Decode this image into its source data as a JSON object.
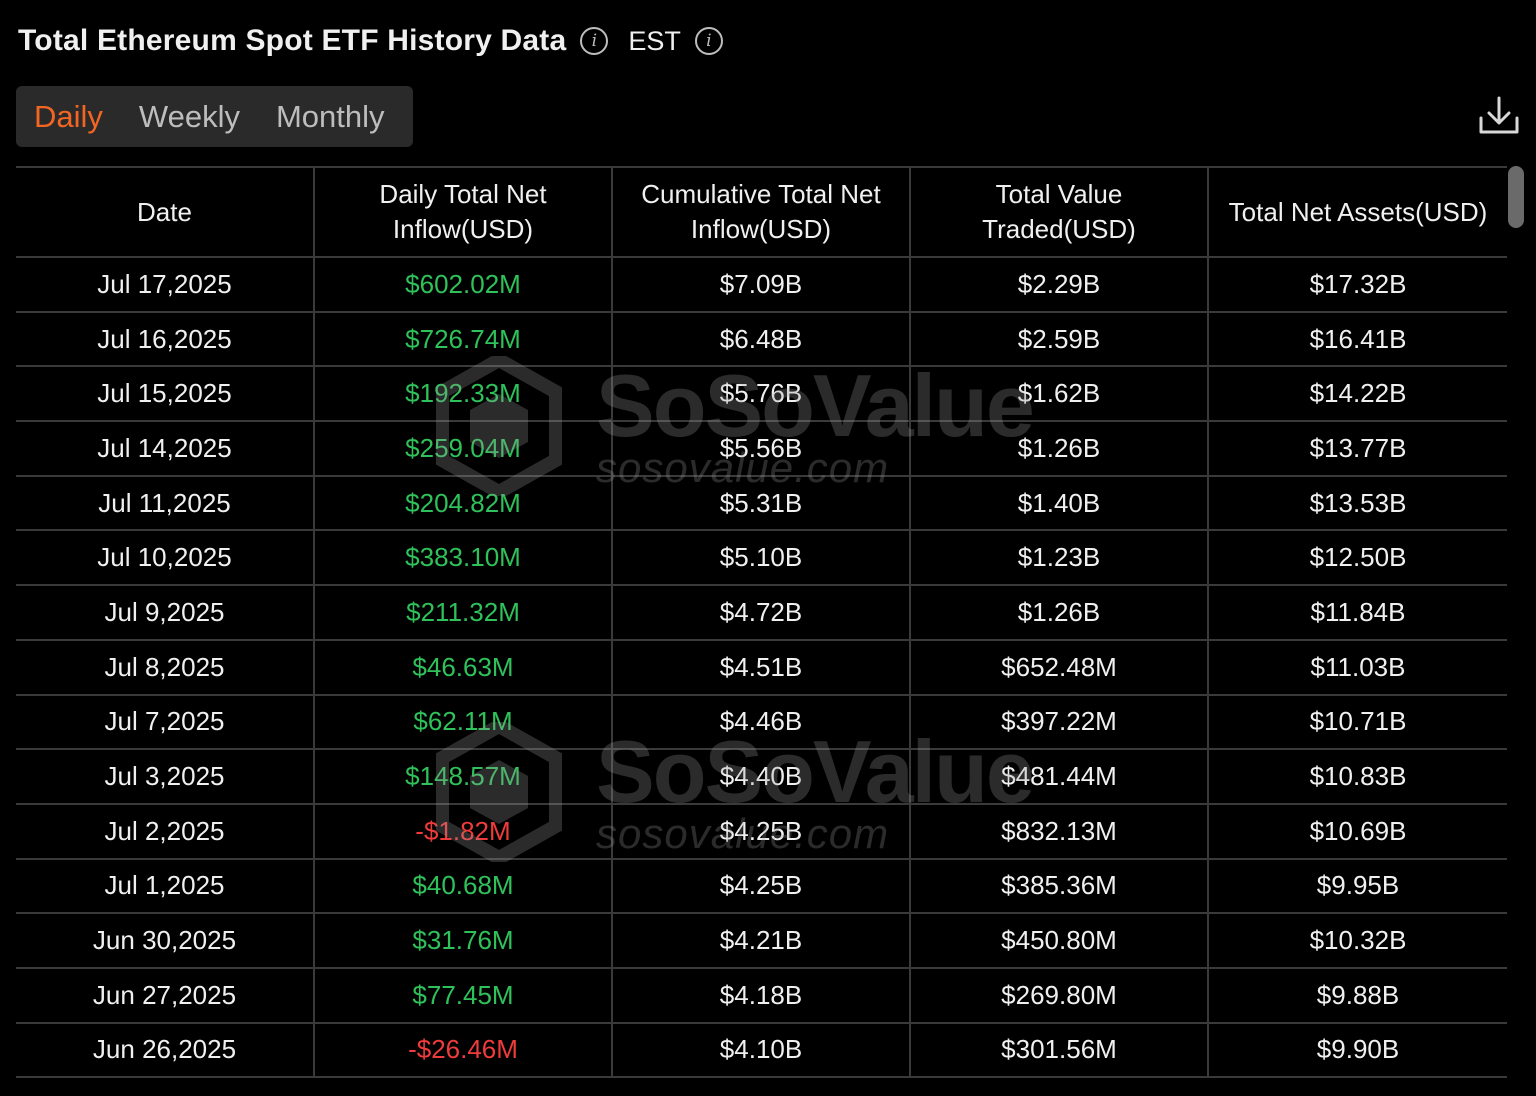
{
  "header": {
    "title": "Total Ethereum Spot ETF History Data",
    "timezone": "EST"
  },
  "tabs": [
    {
      "label": "Daily",
      "active": true
    },
    {
      "label": "Weekly",
      "active": false
    },
    {
      "label": "Monthly",
      "active": false
    }
  ],
  "colors": {
    "accent": "#f26522",
    "positive": "#2fc15a",
    "negative": "#ef3b3b"
  },
  "table": {
    "columns": [
      "Date",
      "Daily Total Net Inflow(USD)",
      "Cumulative Total Net Inflow(USD)",
      "Total Value Traded(USD)",
      "Total Net Assets(USD)"
    ],
    "rows": [
      {
        "date": "Jul 17,2025",
        "daily_net_inflow": "$602.02M",
        "cumulative_net_inflow": "$7.09B",
        "value_traded": "$2.29B",
        "net_assets": "$17.32B"
      },
      {
        "date": "Jul 16,2025",
        "daily_net_inflow": "$726.74M",
        "cumulative_net_inflow": "$6.48B",
        "value_traded": "$2.59B",
        "net_assets": "$16.41B"
      },
      {
        "date": "Jul 15,2025",
        "daily_net_inflow": "$192.33M",
        "cumulative_net_inflow": "$5.76B",
        "value_traded": "$1.62B",
        "net_assets": "$14.22B"
      },
      {
        "date": "Jul 14,2025",
        "daily_net_inflow": "$259.04M",
        "cumulative_net_inflow": "$5.56B",
        "value_traded": "$1.26B",
        "net_assets": "$13.77B"
      },
      {
        "date": "Jul 11,2025",
        "daily_net_inflow": "$204.82M",
        "cumulative_net_inflow": "$5.31B",
        "value_traded": "$1.40B",
        "net_assets": "$13.53B"
      },
      {
        "date": "Jul 10,2025",
        "daily_net_inflow": "$383.10M",
        "cumulative_net_inflow": "$5.10B",
        "value_traded": "$1.23B",
        "net_assets": "$12.50B"
      },
      {
        "date": "Jul 9,2025",
        "daily_net_inflow": "$211.32M",
        "cumulative_net_inflow": "$4.72B",
        "value_traded": "$1.26B",
        "net_assets": "$11.84B"
      },
      {
        "date": "Jul 8,2025",
        "daily_net_inflow": "$46.63M",
        "cumulative_net_inflow": "$4.51B",
        "value_traded": "$652.48M",
        "net_assets": "$11.03B"
      },
      {
        "date": "Jul 7,2025",
        "daily_net_inflow": "$62.11M",
        "cumulative_net_inflow": "$4.46B",
        "value_traded": "$397.22M",
        "net_assets": "$10.71B"
      },
      {
        "date": "Jul 3,2025",
        "daily_net_inflow": "$148.57M",
        "cumulative_net_inflow": "$4.40B",
        "value_traded": "$481.44M",
        "net_assets": "$10.83B"
      },
      {
        "date": "Jul 2,2025",
        "daily_net_inflow": "-$1.82M",
        "cumulative_net_inflow": "$4.25B",
        "value_traded": "$832.13M",
        "net_assets": "$10.69B"
      },
      {
        "date": "Jul 1,2025",
        "daily_net_inflow": "$40.68M",
        "cumulative_net_inflow": "$4.25B",
        "value_traded": "$385.36M",
        "net_assets": "$9.95B"
      },
      {
        "date": "Jun 30,2025",
        "daily_net_inflow": "$31.76M",
        "cumulative_net_inflow": "$4.21B",
        "value_traded": "$450.80M",
        "net_assets": "$10.32B"
      },
      {
        "date": "Jun 27,2025",
        "daily_net_inflow": "$77.45M",
        "cumulative_net_inflow": "$4.18B",
        "value_traded": "$269.80M",
        "net_assets": "$9.88B"
      },
      {
        "date": "Jun 26,2025",
        "daily_net_inflow": "-$26.46M",
        "cumulative_net_inflow": "$4.10B",
        "value_traded": "$301.56M",
        "net_assets": "$9.90B"
      }
    ]
  },
  "watermark": {
    "brand": "SoSoValue",
    "url": "sosovalue.com"
  },
  "icons": {
    "info": "info-icon",
    "download": "download-icon"
  }
}
